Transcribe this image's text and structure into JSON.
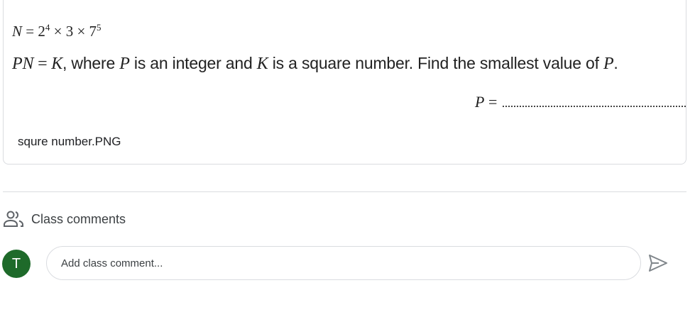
{
  "attachment": {
    "preview": {
      "line1": {
        "lhs": "N",
        "eq": " = ",
        "base1": "2",
        "exp1": "4",
        "times1": " × ",
        "factor2": "3",
        "times2": " × ",
        "base3": "7",
        "exp3": "5"
      },
      "line2": {
        "pn": "PN",
        "eq": " = ",
        "k": "K",
        "text1": ", where ",
        "p": "P",
        "text2": " is an integer and ",
        "k2": "K",
        "text3": " is a square number.  Find the smallest value of ",
        "p2": "P",
        "text4": "."
      },
      "answer": {
        "label": "P",
        "eq": " ="
      }
    },
    "filename": "squre number.PNG"
  },
  "comments": {
    "icon": "people-icon",
    "title": "Class comments",
    "avatar_initial": "T",
    "avatar_color": "#1e6a2a",
    "input_placeholder": "Add class comment...",
    "send_icon": "send-icon"
  }
}
